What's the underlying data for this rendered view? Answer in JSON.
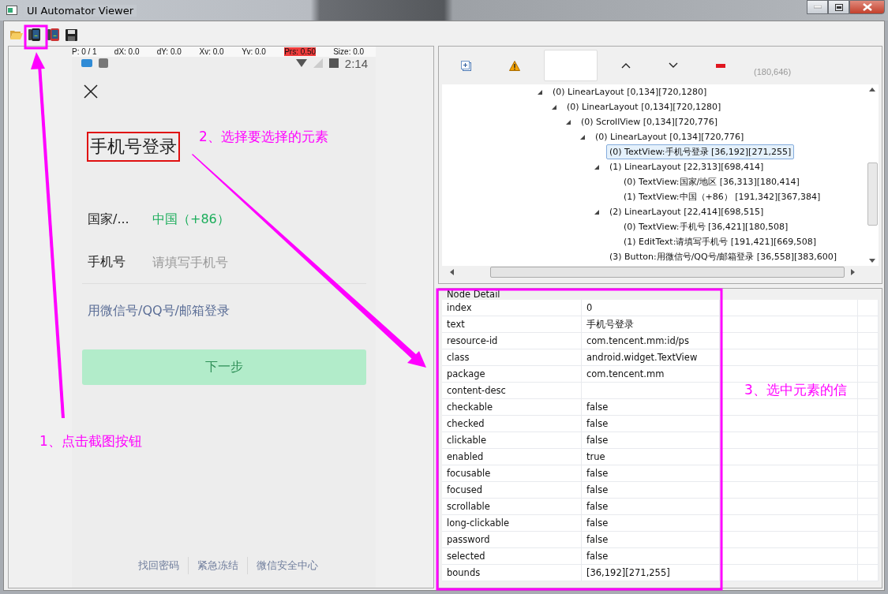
{
  "window": {
    "title": "UI Automator Viewer"
  },
  "device_screen": {
    "pointer_bar": [
      {
        "label": "P: 0 / 1",
        "highlighted": false
      },
      {
        "label": "dX: 0.0",
        "highlighted": false
      },
      {
        "label": "dY: 0.0",
        "highlighted": false
      },
      {
        "label": "Xv: 0.0",
        "highlighted": false
      },
      {
        "label": "Yv: 0.0",
        "highlighted": false
      },
      {
        "label": "Prs: 0.50",
        "highlighted": true
      },
      {
        "label": "Size: 0.0",
        "highlighted": false
      }
    ],
    "status_time": "2:14",
    "title": {
      "text": "手机号登录",
      "highlighted": true
    },
    "fields": [
      {
        "label": "国家/...",
        "value": "中国（+86）"
      },
      {
        "label": "手机号",
        "placeholder": "请填写手机号"
      }
    ],
    "alt_login_link": "用微信号/QQ号/邮箱登录",
    "next_button": {
      "label": "下一步",
      "disabled": true
    },
    "footer_links": [
      "找回密码",
      "紧急冻结",
      "微信安全中心"
    ]
  },
  "tree_toolbar": {
    "coordinates": "(180,646)"
  },
  "tree": [
    {
      "label": "(0) LinearLayout [0,134][720,1280]",
      "expanded": true,
      "selected": false,
      "children": [
        {
          "label": "(0) LinearLayout [0,134][720,1280]",
          "expanded": true,
          "selected": false,
          "children": [
            {
              "label": "(0) ScrollView [0,134][720,776]",
              "expanded": true,
              "selected": false,
              "children": [
                {
                  "label": "(0) LinearLayout [0,134][720,776]",
                  "expanded": true,
                  "selected": false,
                  "children": [
                    {
                      "label": "(0) TextView:手机号登录 [36,192][271,255]",
                      "selected": true
                    },
                    {
                      "label": "(1) LinearLayout [22,313][698,414]",
                      "expanded": true,
                      "selected": false,
                      "children": [
                        {
                          "label": "(0) TextView:国家/地区 [36,313][180,414]",
                          "selected": false
                        },
                        {
                          "label": "(1) TextView:中国（+86） [191,342][367,384]",
                          "selected": false
                        }
                      ]
                    },
                    {
                      "label": "(2) LinearLayout [22,414][698,515]",
                      "expanded": true,
                      "selected": false,
                      "children": [
                        {
                          "label": "(0) TextView:手机号 [36,421][180,508]",
                          "selected": false
                        },
                        {
                          "label": "(1) EditText:请填写手机号 [191,421][669,508]",
                          "selected": false
                        }
                      ]
                    },
                    {
                      "label": "(3) Button:用微信号/QQ号/邮箱登录 [36,558][383,600]",
                      "selected": false
                    }
                  ]
                }
              ]
            }
          ]
        }
      ]
    }
  ],
  "node_detail": {
    "title": "Node Detail",
    "rows": [
      {
        "key": "index",
        "value": "0"
      },
      {
        "key": "text",
        "value": "手机号登录"
      },
      {
        "key": "resource-id",
        "value": "com.tencent.mm:id/ps"
      },
      {
        "key": "class",
        "value": "android.widget.TextView"
      },
      {
        "key": "package",
        "value": "com.tencent.mm"
      },
      {
        "key": "content-desc"
      },
      {
        "key": "checkable",
        "value": "false"
      },
      {
        "key": "checked",
        "value": "false"
      },
      {
        "key": "clickable",
        "value": "false"
      },
      {
        "key": "enabled",
        "value": "true"
      },
      {
        "key": "focusable",
        "value": "false"
      },
      {
        "key": "focused",
        "value": "false"
      },
      {
        "key": "scrollable",
        "value": "false"
      },
      {
        "key": "long-clickable",
        "value": "false"
      },
      {
        "key": "password",
        "value": "false"
      },
      {
        "key": "selected",
        "value": "false"
      },
      {
        "key": "bounds",
        "value": "[36,192][271,255]"
      }
    ]
  },
  "annotations": [
    {
      "text": "1、点击截图按钮"
    },
    {
      "text": "2、选择要选择的元素"
    },
    {
      "text": "3、选中元素的信"
    }
  ]
}
